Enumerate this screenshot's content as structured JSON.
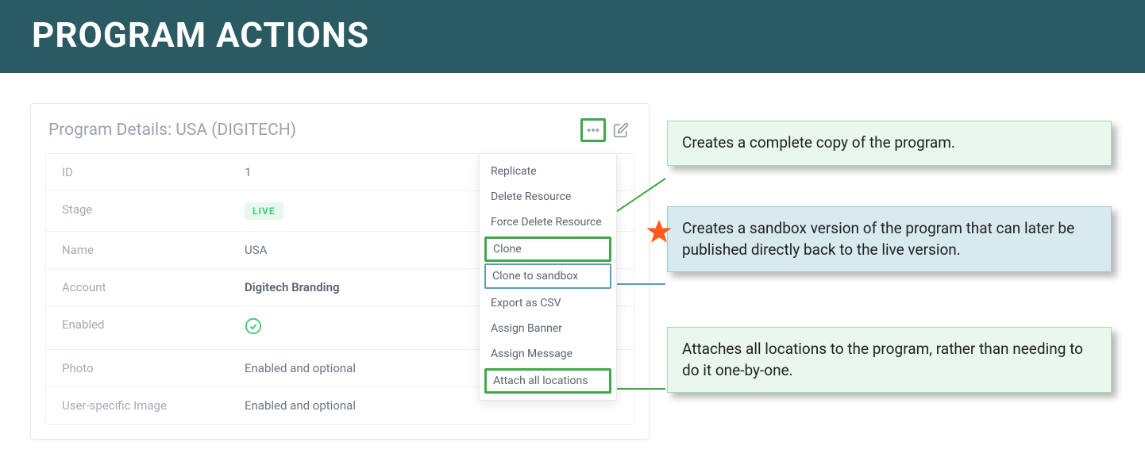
{
  "banner": {
    "title": "PROGRAM ACTIONS"
  },
  "panel": {
    "title": "Program Details: USA (DIGITECH)",
    "rows": [
      {
        "label": "ID",
        "value": "1"
      },
      {
        "label": "Stage",
        "badge": "LIVE"
      },
      {
        "label": "Name",
        "value": "USA"
      },
      {
        "label": "Account",
        "value": "Digitech Branding",
        "bold": true
      },
      {
        "label": "Enabled",
        "check": true
      },
      {
        "label": "Photo",
        "value": "Enabled and optional"
      },
      {
        "label": "User-specific Image",
        "value": "Enabled and optional"
      }
    ]
  },
  "dropdown": {
    "items": [
      {
        "label": "Replicate"
      },
      {
        "label": "Delete Resource"
      },
      {
        "label": "Force Delete Resource"
      },
      {
        "label": "Clone",
        "highlight": "green"
      },
      {
        "label": "Clone to sandbox",
        "highlight": "blue"
      },
      {
        "label": "Export as CSV"
      },
      {
        "label": "Assign Banner"
      },
      {
        "label": "Assign Message"
      },
      {
        "label": "Attach all locations",
        "highlight": "green"
      }
    ]
  },
  "callouts": {
    "c1": "Creates a complete copy of the program.",
    "c2": "Creates a sandbox version of the program that can later be published directly back to the live version.",
    "c3": "Attaches all locations to the program, rather than needing to do it one-by-one."
  },
  "icons": {
    "more": "more-horizontal-icon",
    "edit": "edit-icon",
    "check": "check-circle-icon",
    "star": "star-icon"
  }
}
